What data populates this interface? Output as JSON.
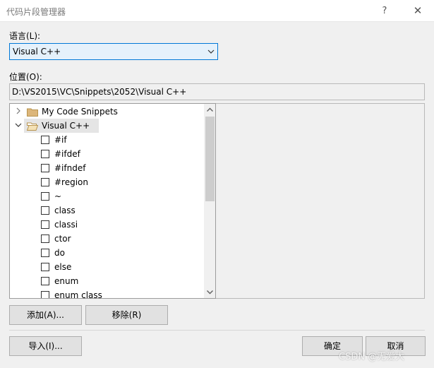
{
  "window": {
    "title": "代码片段管理器",
    "help": "?",
    "close": "✕"
  },
  "language": {
    "label": "语言(L):",
    "selected": "Visual C++"
  },
  "location": {
    "label": "位置(O):",
    "path": "D:\\VS2015\\VC\\Snippets\\2052\\Visual C++"
  },
  "tree": {
    "folders": [
      {
        "name": "My Code Snippets",
        "expanded": false
      },
      {
        "name": "Visual C++",
        "expanded": true
      }
    ],
    "snippets": [
      "#if",
      "#ifdef",
      "#ifndef",
      "#region",
      "~",
      "class",
      "classi",
      "ctor",
      "do",
      "else",
      "enum",
      "enum class"
    ]
  },
  "buttons": {
    "add": "添加(A)...",
    "remove": "移除(R)",
    "import": "导入(I)...",
    "ok": "确定",
    "cancel": "取消"
  },
  "watermark": "CSDN @无爱大",
  "colors": {
    "accent": "#0078d7",
    "folder": "#dcb67a"
  }
}
